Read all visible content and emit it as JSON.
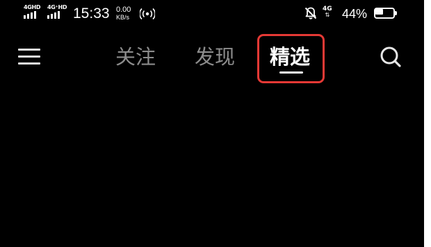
{
  "status_bar": {
    "sim1_label": "4GHD",
    "sim2_label": "4G⁺HD",
    "time": "15:33",
    "net_speed_value": "0.00",
    "net_speed_unit": "KB/s",
    "hotspot_icon": "hotspot-icon",
    "mute_icon": "bell-off-icon",
    "data_type": "4G",
    "data_arrows": "⇅",
    "battery_percent": "44%",
    "battery_level": 0.44
  },
  "top_nav": {
    "menu_icon": "menu-icon",
    "tabs": [
      {
        "label": "关注",
        "selected": false
      },
      {
        "label": "发现",
        "selected": false
      },
      {
        "label": "精选",
        "selected": true
      }
    ],
    "search_icon": "search-icon"
  },
  "colors": {
    "background": "#000000",
    "selected_tab": "#ffffff",
    "unselected_tab": "#8c8c8c",
    "highlight_border": "#e53935"
  }
}
